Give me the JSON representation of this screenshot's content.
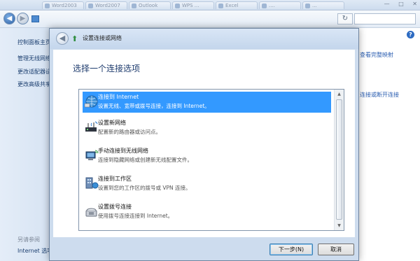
{
  "browser_tabs": [
    "Word2003",
    "Word2007",
    "Outlook",
    "WPS ...",
    "Excel",
    "....",
    "..."
  ],
  "window_controls": [
    "—",
    "□",
    "✕"
  ],
  "sidebar": {
    "home": "控制面板主页",
    "links": [
      "管理无线网络",
      "更改适配器设置",
      "更改高级共享设置"
    ],
    "see_also_label": "另请参阅",
    "see_also_items": [
      "Internet 选项"
    ]
  },
  "right_links": [
    "查看完整映射",
    "连接或断开连接"
  ],
  "dialog": {
    "title": "设置连接或网络",
    "heading": "选择一个连接选项",
    "options": [
      {
        "title": "连接到 Internet",
        "desc": "设置无线、宽带或拨号连接，连接到 Internet。",
        "icon": "globe-network-icon",
        "selected": true
      },
      {
        "title": "设置新网络",
        "desc": "配置新的路由器或访问点。",
        "icon": "router-icon",
        "selected": false
      },
      {
        "title": "手动连接到无线网络",
        "desc": "连接到隐藏网络或创建新无线配置文件。",
        "icon": "wireless-computer-icon",
        "selected": false
      },
      {
        "title": "连接到工作区",
        "desc": "设置到您的工作区的拨号或 VPN 连接。",
        "icon": "workplace-network-icon",
        "selected": false
      },
      {
        "title": "设置拨号连接",
        "desc": "使用拨号连接连接到 Internet。",
        "icon": "dialup-phone-icon",
        "selected": false
      }
    ],
    "next_button": "下一步(N)",
    "cancel_button": "取消"
  },
  "colors": {
    "selection": "#3399ff",
    "heading": "#1f3c6e",
    "link": "#2a5db0"
  }
}
